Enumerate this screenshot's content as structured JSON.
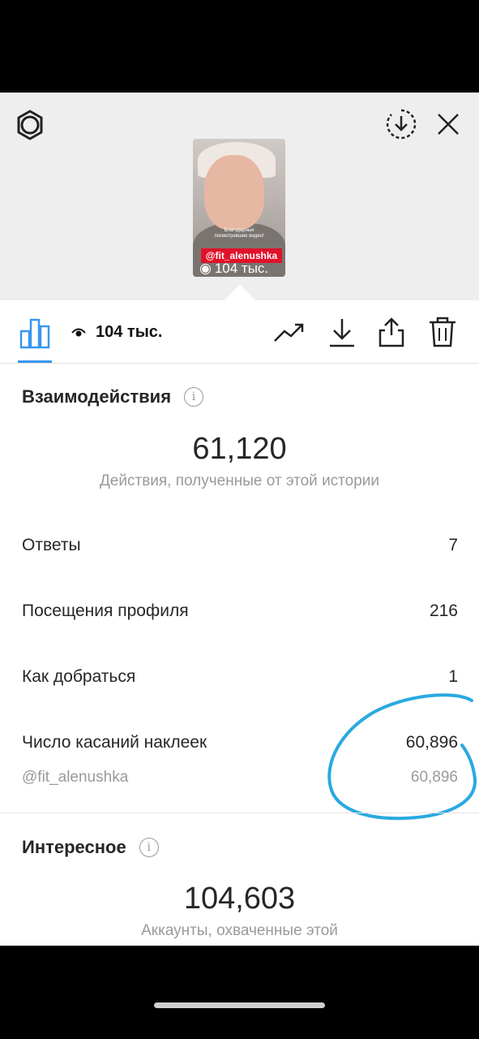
{
  "preview": {
    "thumbnail": {
      "caption": "Благодарные посмотревшие видео!",
      "mention": "@fit_alenushka",
      "views": "104 тыс."
    }
  },
  "toolbar": {
    "views_label": "104 тыс."
  },
  "interactions": {
    "title": "Взаимодействия",
    "total": "61,120",
    "caption": "Действия, полученные от этой истории",
    "rows": [
      {
        "label": "Ответы",
        "value": "7"
      },
      {
        "label": "Посещения профиля",
        "value": "216"
      },
      {
        "label": "Как добраться",
        "value": "1"
      },
      {
        "label": "Число касаний наклеек",
        "value": "60,896"
      }
    ],
    "sticker": {
      "label": "@fit_alenushka",
      "value": "60,896"
    }
  },
  "discovery": {
    "title": "Интересное",
    "total": "104,603",
    "caption": "Аккаунты, охваченные этой"
  },
  "colors": {
    "accent": "#3897f0",
    "annotation": "#2aa9e0",
    "story_tag": "#e0122b"
  }
}
